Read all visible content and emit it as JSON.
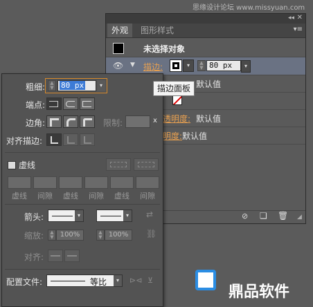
{
  "watermark_top": "思缘设计论坛 www.missyuan.com",
  "appearance": {
    "tabs": [
      "外观",
      "图形样式"
    ],
    "title": "未选择对象",
    "stroke_label": "描边:",
    "stroke_value": "80 px",
    "tooltip": "描边面板",
    "rows": [
      {
        "label": "",
        "value": "默认值"
      },
      {
        "label": "",
        "value": ""
      },
      {
        "label": "透明度:",
        "value": "默认值"
      },
      {
        "label": "明度:",
        "value": "默认值"
      }
    ]
  },
  "stroke": {
    "weight_label": "粗细:",
    "weight_value": "80 px",
    "cap_label": "端点:",
    "corner_label": "边角:",
    "limit_label": "限制:",
    "limit_suffix": "x",
    "align_label": "对齐描边:",
    "dashed_label": "虚线",
    "dash_labels": [
      "虚线",
      "间隙",
      "虚线",
      "间隙",
      "虚线",
      "间隙"
    ],
    "arrow_label": "箭头:",
    "scale_label": "缩放:",
    "scale_value_1": "100%",
    "scale_value_2": "100%",
    "align_arrow_label": "对齐:",
    "profile_label": "配置文件:",
    "profile_value": "等比"
  },
  "logo_text": "鼎品软件"
}
